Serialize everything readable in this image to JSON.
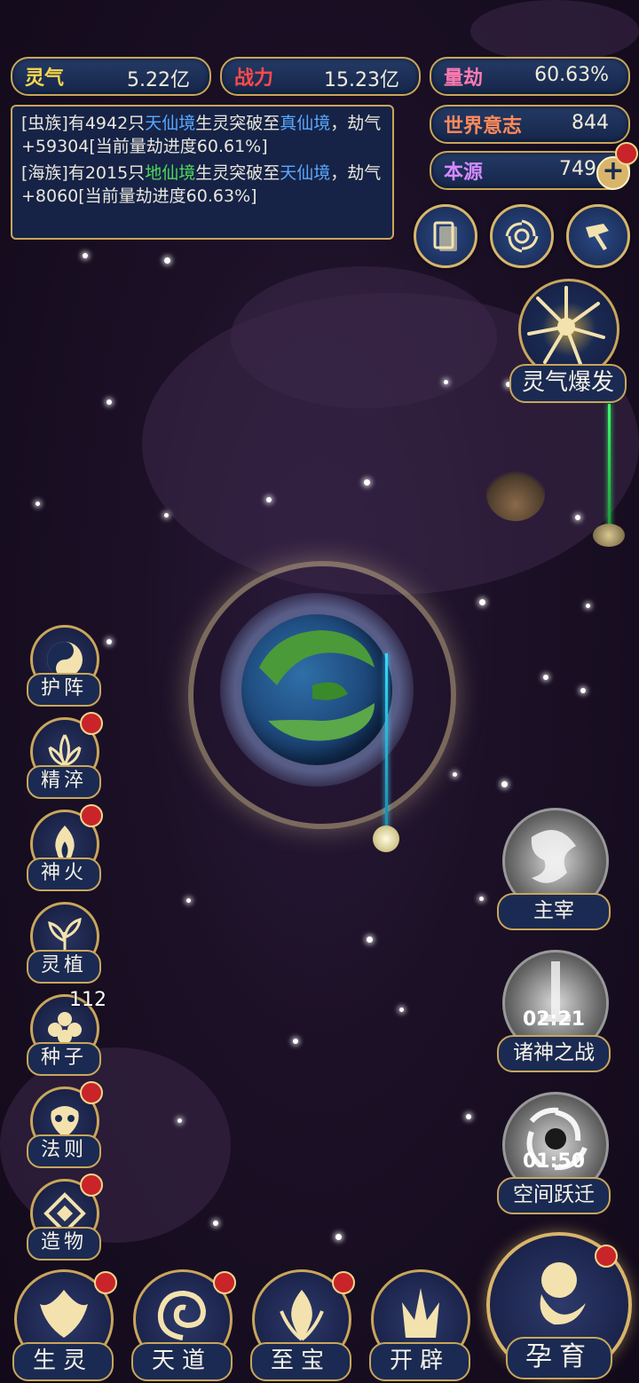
{
  "stats": {
    "lingqi": {
      "label": "灵气",
      "value": "5.22亿",
      "color": "#ffd84a"
    },
    "zhanli": {
      "label": "战力",
      "value": "15.23亿",
      "color": "#ff4a4a"
    },
    "liangjie": {
      "label": "量劫",
      "value": "60.63%",
      "color": "#ff7ab0"
    },
    "shijie": {
      "label": "世界意志",
      "value": "844",
      "color": "#ff8a5a"
    },
    "benyuan": {
      "label": "本源",
      "value": "749",
      "color": "#d48aff"
    }
  },
  "news": {
    "line1_a": "[虫族]有4942只",
    "line1_b": "天仙境",
    "line1_c": "生灵突破至",
    "line1_d": "真仙境",
    "line1_e": "，劫气+59304[当前量劫进度60.61%]",
    "line2_a": "[海族]有2015只",
    "line2_b": "地仙境",
    "line2_c": "生灵突破至",
    "line2_d": "天仙境",
    "line2_e": "，劫气+8060[当前量劫进度60.63%]"
  },
  "burst": {
    "label": "灵气爆发"
  },
  "left_menu": [
    {
      "label": "护阵"
    },
    {
      "label": "精淬"
    },
    {
      "label": "神火"
    },
    {
      "label": "灵植"
    },
    {
      "label": "种子",
      "badge": "112"
    },
    {
      "label": "法则"
    },
    {
      "label": "造物"
    }
  ],
  "right_menu": {
    "zhuzai": {
      "label": "主宰"
    },
    "zhushen": {
      "label": "诸神之战",
      "timer": "02:21"
    },
    "kongjian": {
      "label": "空间跃迁",
      "timer": "01:50"
    }
  },
  "bottom_menu": {
    "shengling": "生灵",
    "tiandao": "天道",
    "zhibao": "至宝",
    "kaipi": "开辟",
    "yunyu": "孕育"
  }
}
